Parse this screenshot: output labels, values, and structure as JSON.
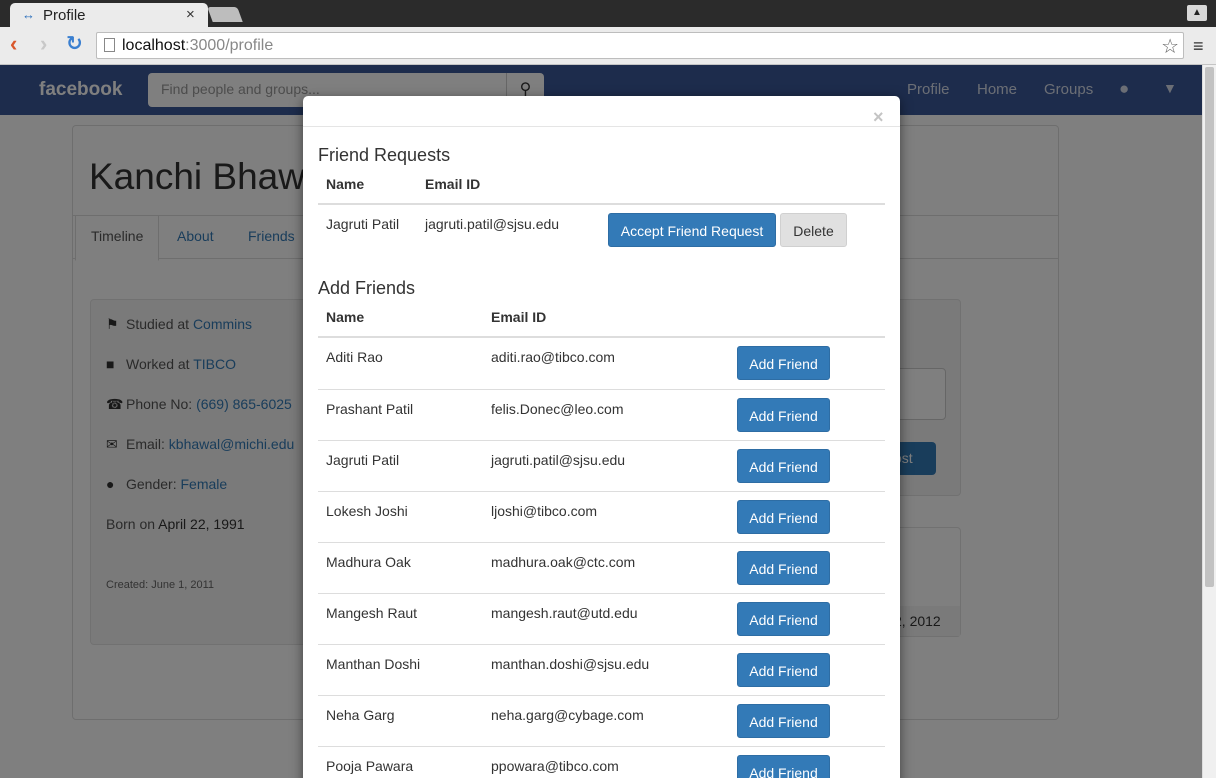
{
  "browser": {
    "tab_title": "Profile",
    "tab_close": "×",
    "url_host": "localhost",
    "url_rest": ":3000/profile"
  },
  "navbar": {
    "brand": "facebook",
    "search_placeholder": "Find people and groups...",
    "links": [
      "Profile",
      "Home",
      "Groups"
    ]
  },
  "profile": {
    "name": "Kanchi Bhawa",
    "tabs": [
      "Timeline",
      "About",
      "Friends"
    ],
    "about": {
      "studied_prefix": "Studied at ",
      "studied_value": "Commins",
      "worked_prefix": "Worked at ",
      "worked_value": "TIBCO",
      "phone_prefix": "Phone No: ",
      "phone_value": "(669) 865-6025",
      "email_prefix": "Email: ",
      "email_value": "kbhawal@michi.edu",
      "gender_prefix": "Gender: ",
      "gender_value": "Female",
      "born_prefix": "Born on ",
      "born_value": "April 22, 1991",
      "created": "Created: June 1, 2011"
    },
    "right_post_fragment": "ost",
    "right_date_fragment": "2, 2012"
  },
  "modal": {
    "close": "×",
    "friend_requests": {
      "title": "Friend Requests",
      "headers": {
        "name": "Name",
        "email": "Email ID"
      },
      "rows": [
        {
          "name": "Jagruti Patil",
          "email": "jagruti.patil@sjsu.edu",
          "accept": "Accept Friend Request",
          "delete": "Delete"
        }
      ]
    },
    "add_friends": {
      "title": "Add Friends",
      "headers": {
        "name": "Name",
        "email": "Email ID"
      },
      "button": "Add Friend",
      "rows": [
        {
          "name": "Aditi Rao",
          "email": "aditi.rao@tibco.com"
        },
        {
          "name": "Prashant Patil",
          "email": "felis.Donec@leo.com"
        },
        {
          "name": "Jagruti Patil",
          "email": "jagruti.patil@sjsu.edu"
        },
        {
          "name": "Lokesh Joshi",
          "email": "ljoshi@tibco.com"
        },
        {
          "name": "Madhura Oak",
          "email": "madhura.oak@ctc.com"
        },
        {
          "name": "Mangesh Raut",
          "email": "mangesh.raut@utd.edu"
        },
        {
          "name": "Manthan Doshi",
          "email": "manthan.doshi@sjsu.edu"
        },
        {
          "name": "Neha Garg",
          "email": "neha.garg@cybage.com"
        },
        {
          "name": "Pooja Pawara",
          "email": "ppowara@tibco.com"
        }
      ]
    }
  }
}
